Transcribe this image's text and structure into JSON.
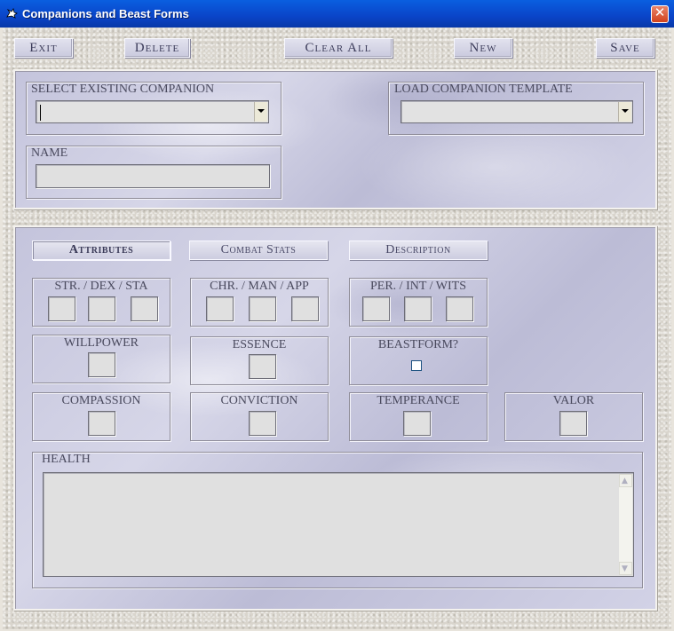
{
  "window": {
    "title": "Companions and Beast Forms"
  },
  "toolbar": {
    "exit": "Exit",
    "delete": "Delete",
    "clear_all": "Clear All",
    "new": "New",
    "save": "Save"
  },
  "top_panel": {
    "select_existing_label": "SELECT EXISTING COMPANION",
    "select_existing_value": "",
    "load_template_label": "LOAD COMPANION TEMPLATE",
    "load_template_value": "",
    "name_label": "NAME",
    "name_value": ""
  },
  "tabs": [
    {
      "label": "Attributes",
      "active": true
    },
    {
      "label": "Combat Stats",
      "active": false
    },
    {
      "label": "Description",
      "active": false
    }
  ],
  "attributes": {
    "physical_label": "STR. / DEX / STA",
    "social_label": "CHR. / MAN / APP",
    "mental_label": "PER. / INT / WITS",
    "willpower_label": "WILLPOWER",
    "essence_label": "ESSENCE",
    "beastform_label": "BEASTFORM?",
    "beastform_checked": false,
    "compassion_label": "COMPASSION",
    "conviction_label": "CONVICTION",
    "temperance_label": "TEMPERANCE",
    "valor_label": "VALOR",
    "health_label": "HEALTH",
    "health_value": ""
  },
  "icons": {
    "app": "dragon-icon",
    "close": "close-icon",
    "dropdown": "chevron-down-icon",
    "scroll_up": "scroll-up-icon",
    "scroll_down": "scroll-down-icon"
  },
  "colors": {
    "titlebar": "#0a44c8",
    "close_button": "#d2421c",
    "panel_marble": "#c8c8de",
    "label_text": "#4a4a5e"
  }
}
